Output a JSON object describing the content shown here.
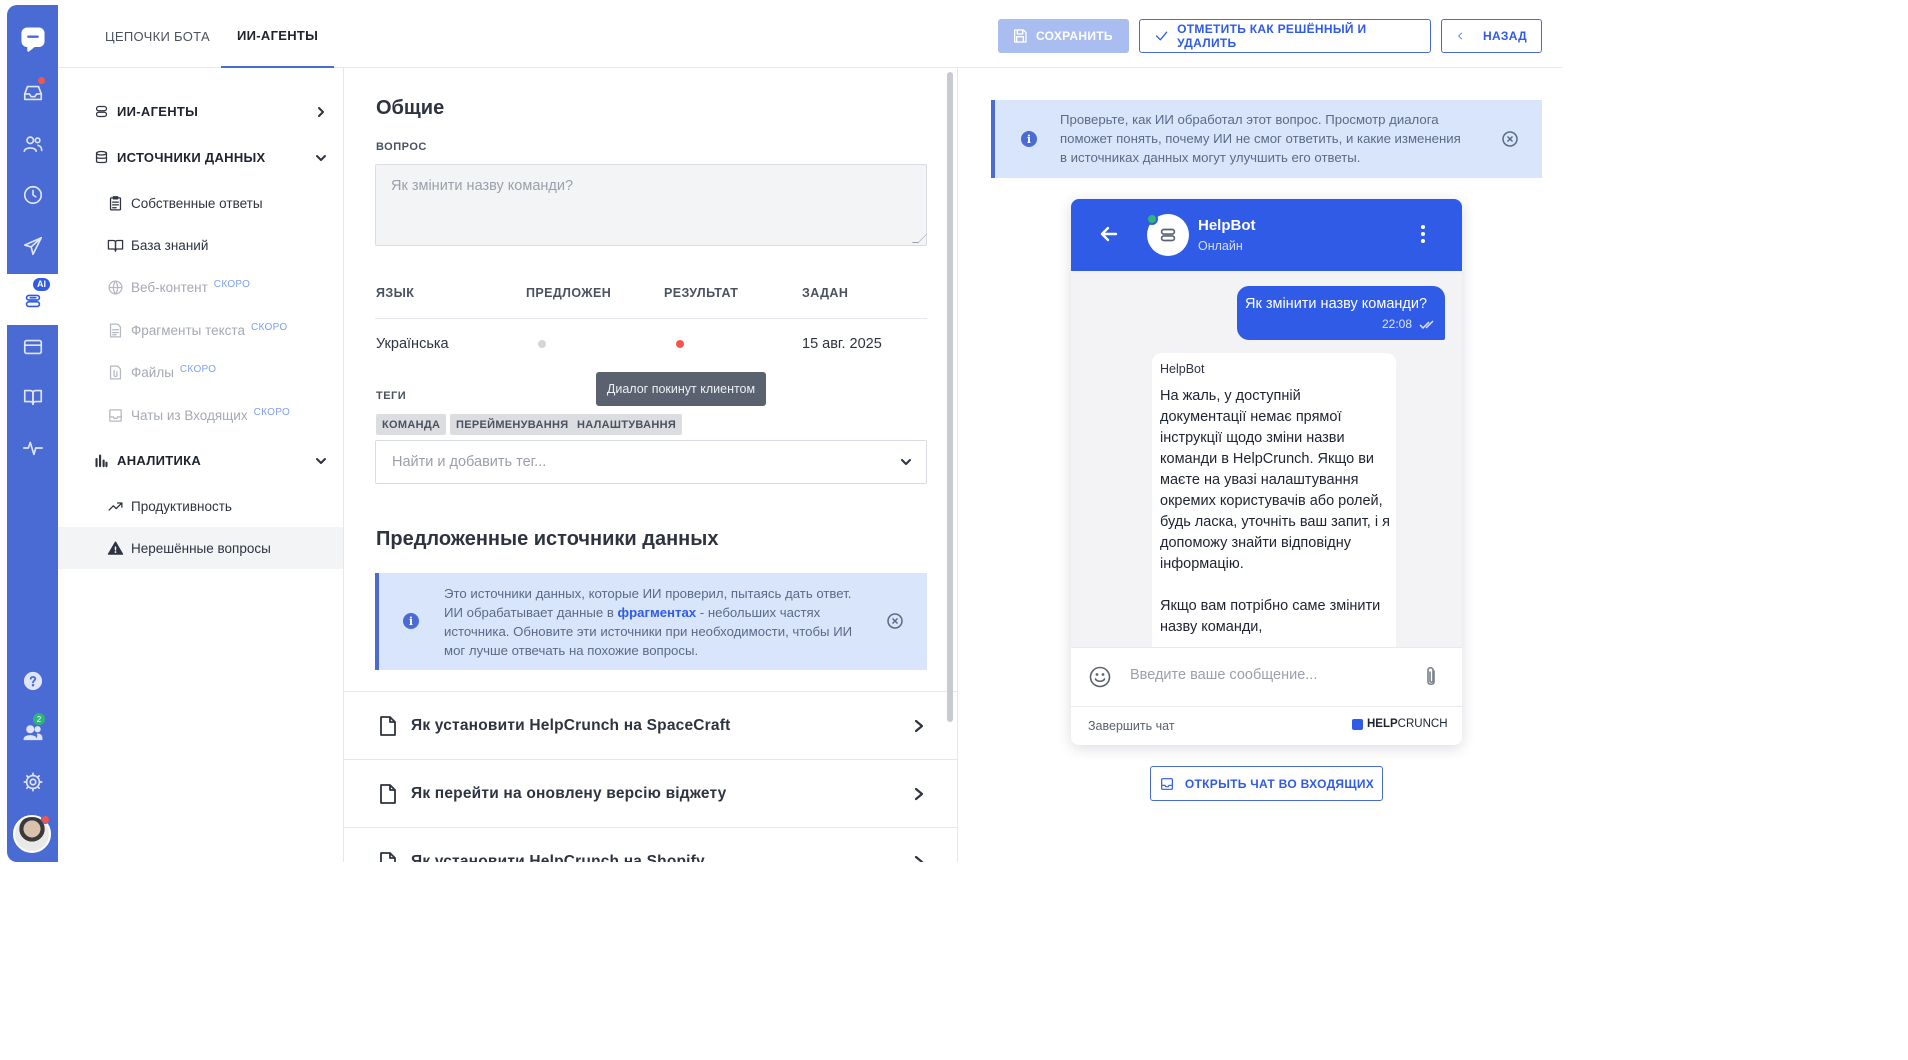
{
  "top_tabs": [
    {
      "label": "ЦЕПОЧКИ БОТА"
    },
    {
      "label": "ИИ-АГЕНТЫ",
      "active": true
    }
  ],
  "toolbar": {
    "save_label": "СОХРАНИТЬ",
    "resolve_label": "ОТМЕТИТЬ КАК РЕШЁННЫЙ И УДАЛИТЬ",
    "back_label": "НАЗАД"
  },
  "rail": {
    "ai_badge": "AI",
    "team_count": "2"
  },
  "nav": {
    "ai_agents": "ИИ-АГЕНТЫ",
    "data_sources": "ИСТОЧНИКИ ДАННЫХ",
    "items": [
      {
        "label": "Собственные ответы",
        "icon": "document-list-icon"
      },
      {
        "label": "База знаний",
        "icon": "book-icon"
      },
      {
        "label": "Веб-контент",
        "icon": "globe-icon",
        "soon": "СКОРО"
      },
      {
        "label": "Фрагменты текста",
        "icon": "text-snippet-icon",
        "soon": "СКОРО"
      },
      {
        "label": "Файлы",
        "icon": "file-icon",
        "soon": "СКОРО"
      },
      {
        "label": "Чаты из Входящих",
        "icon": "inbox-icon",
        "soon": "СКОРО"
      }
    ],
    "analytics": "АНАЛИТИКА",
    "analytics_items": [
      {
        "label": "Продуктивность",
        "icon": "trend-icon"
      },
      {
        "label": "Нерешённые вопросы",
        "icon": "warning-icon",
        "selected": true
      }
    ]
  },
  "general": {
    "title": "Общие",
    "question_label": "ВОПРОС",
    "question_placeholder": "Як змінити назву команди?",
    "columns": [
      "ЯЗЫК",
      "ПРЕДЛОЖЕН",
      "РЕЗУЛЬТАТ",
      "ЗАДАН"
    ],
    "row": {
      "language": "Українська",
      "asked": "15 авг. 2025"
    },
    "tooltip": "Диалог покинут клиентом",
    "tags_label": "ТЕГИ",
    "tags": [
      "КОМАНДА",
      "ПЕРЕЙМЕНУВАННЯ",
      "НАЛАШТУВАННЯ"
    ],
    "tag_search_placeholder": "Найти и добавить тег..."
  },
  "suggested": {
    "title": "Предложенные источники данных",
    "info_part1": "Это источники данных, которые ИИ проверил, пытаясь дать ответ. ИИ обрабатывает данные в ",
    "info_bold": "фрагментах",
    "info_part2": " - небольших частях источника. Обновите эти источники при необходимости, чтобы ИИ мог лучше отвечать на похожие вопросы.",
    "sources": [
      "Як установити HelpCrunch на SpaceCraft",
      "Як перейти на оновлену версію віджету",
      "Як установити HelpCrunch на Shopify"
    ]
  },
  "preview": {
    "info": "Проверьте, как ИИ обработал этот вопрос. Просмотр диалога поможет понять, почему ИИ не смог ответить, и какие изменения в источниках данных могут улучшить его ответы.",
    "bot_name": "HelpBot",
    "bot_status": "Онлайн",
    "user_message": "Як змінити назву команди?",
    "user_time": "22:08",
    "bot_sender": "HelpBot",
    "bot_message_p1": "На жаль, у доступній документації немає прямої інструкції щодо зміни назви команди в HelpCrunch. Якщо ви маєте на увазі налаштування окремих користувачів або ролей, будь ласка, уточніть ваш запит, і я допоможу знайти відповідну інформацію.",
    "bot_message_p2": "Якщо вам потрібно саме змінити назву команди,",
    "input_placeholder": "Введите ваше сообщение...",
    "end_chat": "Завершить чат",
    "brand_bold": "HELP",
    "brand_rest": "CRUNCH",
    "open_inbox": "ОТКРЫТЬ ЧАТ ВО ВХОДЯЩИХ"
  },
  "colors": {
    "accent": "#2f5be7",
    "rail": "#4a6bd4",
    "info_bg": "#d9e5fb",
    "alert_dot": "#f4564f",
    "online": "#2fb57b"
  }
}
